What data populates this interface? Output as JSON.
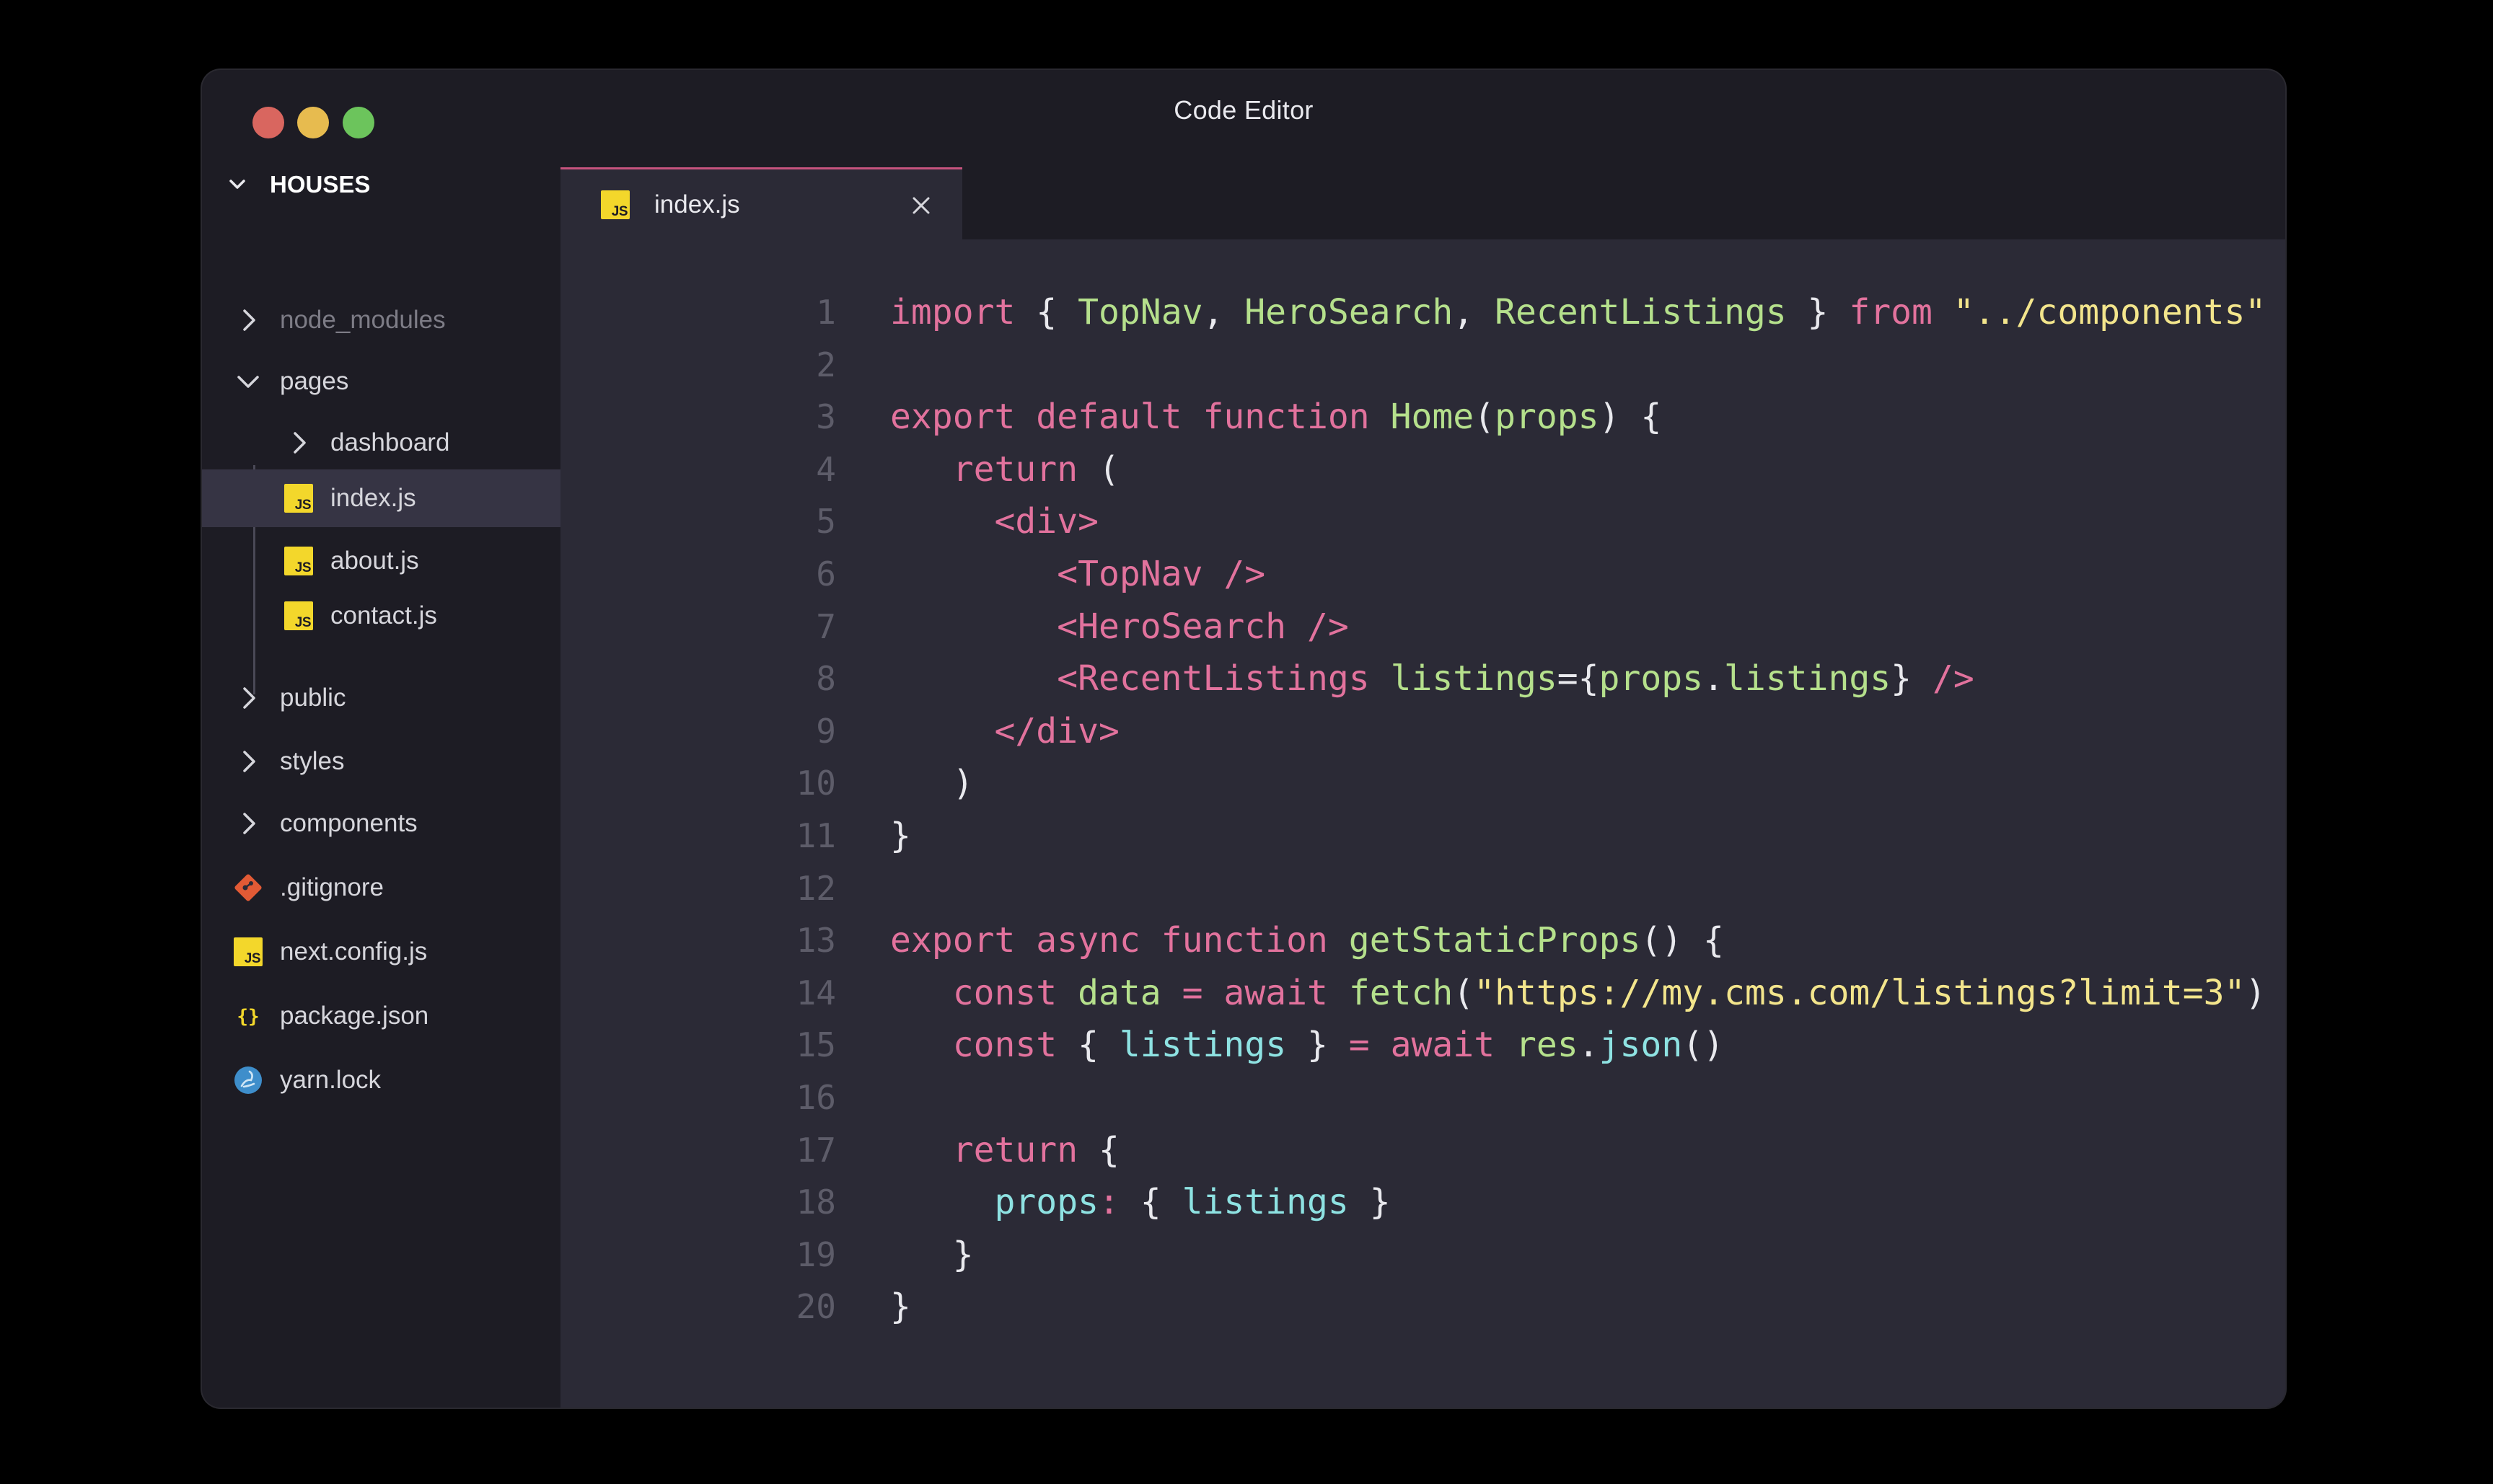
{
  "window": {
    "title": "Code Editor"
  },
  "sidebar": {
    "project": "HOUSES",
    "items": [
      {
        "label": "node_modules",
        "kind": "folder",
        "expanded": false,
        "depth": 0
      },
      {
        "label": "pages",
        "kind": "folder",
        "expanded": true,
        "depth": 0
      },
      {
        "label": "dashboard",
        "kind": "folder",
        "expanded": false,
        "depth": 1
      },
      {
        "label": "index.js",
        "kind": "js",
        "depth": 1,
        "selected": true
      },
      {
        "label": "about.js",
        "kind": "js",
        "depth": 1
      },
      {
        "label": "contact.js",
        "kind": "js",
        "depth": 1
      },
      {
        "label": "public",
        "kind": "folder",
        "expanded": false,
        "depth": 0
      },
      {
        "label": "styles",
        "kind": "folder",
        "expanded": false,
        "depth": 0
      },
      {
        "label": "components",
        "kind": "folder",
        "expanded": false,
        "depth": 0
      },
      {
        "label": ".gitignore",
        "kind": "git",
        "depth": 0
      },
      {
        "label": "next.config.js",
        "kind": "js",
        "depth": 0
      },
      {
        "label": "package.json",
        "kind": "json",
        "depth": 0
      },
      {
        "label": "yarn.lock",
        "kind": "yarn",
        "depth": 0
      }
    ]
  },
  "editor": {
    "tab": {
      "label": "index.js"
    },
    "lines": [
      {
        "n": "1",
        "tokens": [
          [
            "kw",
            "import"
          ],
          [
            "punc",
            " { "
          ],
          [
            "fn",
            "TopNav"
          ],
          [
            "punc",
            ", "
          ],
          [
            "fn",
            "HeroSearch"
          ],
          [
            "punc",
            ", "
          ],
          [
            "fn",
            "RecentListings"
          ],
          [
            "punc",
            " } "
          ],
          [
            "kw",
            "from"
          ],
          [
            "punc",
            " "
          ],
          [
            "str",
            "\"../components\""
          ]
        ]
      },
      {
        "n": "2",
        "tokens": []
      },
      {
        "n": "3",
        "tokens": [
          [
            "kw",
            "export default function"
          ],
          [
            "punc",
            " "
          ],
          [
            "fn",
            "Home"
          ],
          [
            "punc",
            "("
          ],
          [
            "fn",
            "props"
          ],
          [
            "punc",
            ") {"
          ]
        ]
      },
      {
        "n": "4",
        "tokens": [
          [
            "punc",
            "   "
          ],
          [
            "kw",
            "return"
          ],
          [
            "punc",
            " ("
          ]
        ]
      },
      {
        "n": "5",
        "tokens": [
          [
            "punc",
            "     "
          ],
          [
            "tag",
            "<div>"
          ]
        ]
      },
      {
        "n": "6",
        "tokens": [
          [
            "punc",
            "        "
          ],
          [
            "tag",
            "<TopNav />"
          ]
        ]
      },
      {
        "n": "7",
        "tokens": [
          [
            "punc",
            "        "
          ],
          [
            "tag",
            "<HeroSearch />"
          ]
        ]
      },
      {
        "n": "8",
        "tokens": [
          [
            "punc",
            "        "
          ],
          [
            "tag",
            "<RecentListings "
          ],
          [
            "fn",
            "listings"
          ],
          [
            "punc",
            "={"
          ],
          [
            "fn",
            "props"
          ],
          [
            "punc",
            "."
          ],
          [
            "fn",
            "listings"
          ],
          [
            "punc",
            "} "
          ],
          [
            "tag",
            "/>"
          ]
        ]
      },
      {
        "n": "9",
        "tokens": [
          [
            "punc",
            "     "
          ],
          [
            "tag",
            "</div>"
          ]
        ]
      },
      {
        "n": "10",
        "tokens": [
          [
            "punc",
            "   )"
          ]
        ]
      },
      {
        "n": "11",
        "tokens": [
          [
            "punc",
            "}"
          ]
        ]
      },
      {
        "n": "12",
        "tokens": []
      },
      {
        "n": "13",
        "tokens": [
          [
            "kw",
            "export async function"
          ],
          [
            "punc",
            " "
          ],
          [
            "fn",
            "getStaticProps"
          ],
          [
            "punc",
            "() {"
          ]
        ]
      },
      {
        "n": "14",
        "tokens": [
          [
            "punc",
            "   "
          ],
          [
            "kw",
            "const"
          ],
          [
            "punc",
            " "
          ],
          [
            "fn",
            "data"
          ],
          [
            "punc",
            " "
          ],
          [
            "kw",
            "="
          ],
          [
            "punc",
            " "
          ],
          [
            "kw",
            "await"
          ],
          [
            "punc",
            " "
          ],
          [
            "fn",
            "fetch"
          ],
          [
            "punc",
            "("
          ],
          [
            "str",
            "\"https://my.cms.com/listings?limit=3\""
          ],
          [
            "punc",
            ")"
          ]
        ]
      },
      {
        "n": "15",
        "tokens": [
          [
            "punc",
            "   "
          ],
          [
            "kw",
            "const"
          ],
          [
            "punc",
            " { "
          ],
          [
            "prop",
            "listings"
          ],
          [
            "punc",
            " } "
          ],
          [
            "kw",
            "="
          ],
          [
            "punc",
            " "
          ],
          [
            "kw",
            "await"
          ],
          [
            "punc",
            " "
          ],
          [
            "fn",
            "res"
          ],
          [
            "punc",
            "."
          ],
          [
            "prop",
            "json"
          ],
          [
            "punc",
            "()"
          ]
        ]
      },
      {
        "n": "16",
        "tokens": []
      },
      {
        "n": "17",
        "tokens": [
          [
            "punc",
            "   "
          ],
          [
            "kw",
            "return"
          ],
          [
            "punc",
            " {"
          ]
        ]
      },
      {
        "n": "18",
        "tokens": [
          [
            "punc",
            "     "
          ],
          [
            "prop",
            "props"
          ],
          [
            "kw",
            ":"
          ],
          [
            "punc",
            " { "
          ],
          [
            "prop",
            "listings"
          ],
          [
            "punc",
            " }"
          ]
        ]
      },
      {
        "n": "19",
        "tokens": [
          [
            "punc",
            "   }"
          ]
        ]
      },
      {
        "n": "20",
        "tokens": [
          [
            "punc",
            "}"
          ]
        ]
      }
    ]
  },
  "colors": {
    "accent": "#c6537e",
    "keyword": "#e2729d",
    "function": "#b5e08c",
    "string": "#f3e58c",
    "property": "#8ee2e2"
  }
}
